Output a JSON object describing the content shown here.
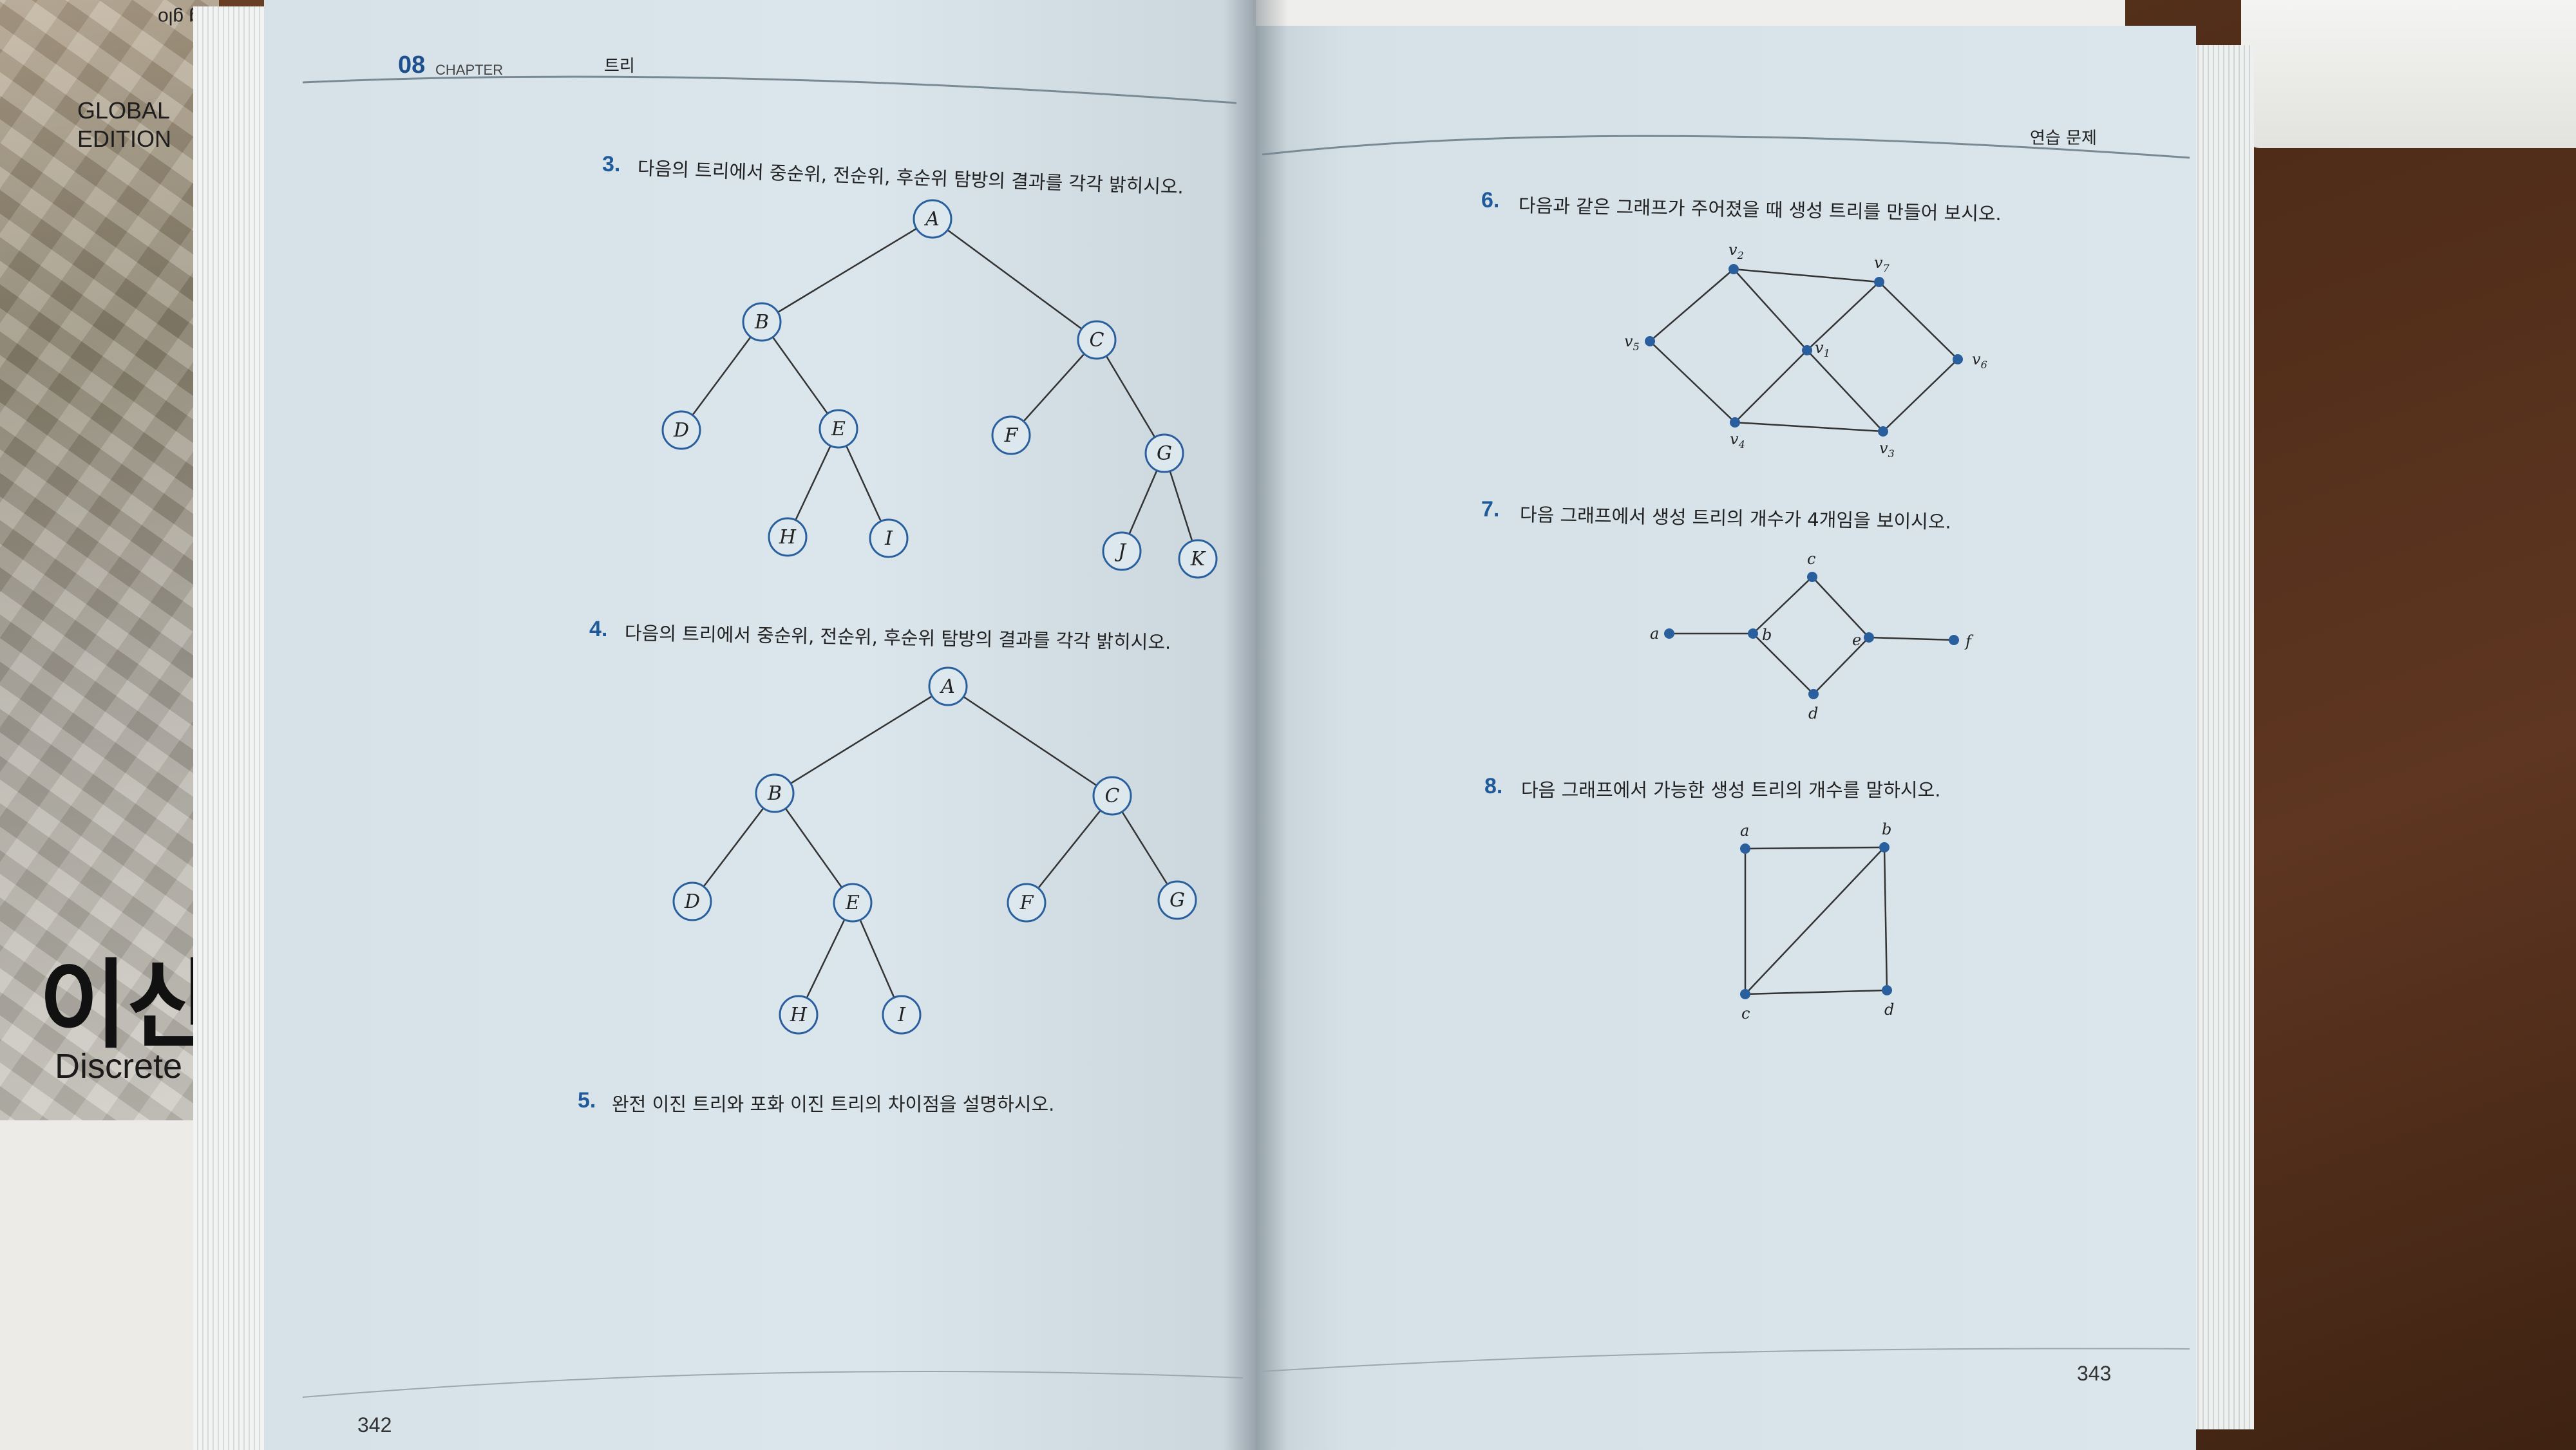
{
  "cover": {
    "edition": [
      "GLOBAL",
      "EDITION"
    ],
    "title": "이산",
    "subtitle": "Discrete",
    "spine": "ing glo"
  },
  "left_page": {
    "chapter_number": "08",
    "chapter_word": "CHAPTER",
    "chapter_title": "트리",
    "page_number": "342",
    "q3": {
      "num": "3.",
      "text": "다음의 트리에서 중순위, 전순위, 후순위 탐방의 결과를 각각 밝히시오."
    },
    "q4": {
      "num": "4.",
      "text": "다음의 트리에서 중순위, 전순위, 후순위 탐방의 결과를 각각 밝히시오."
    },
    "q5": {
      "num": "5.",
      "text": "완전 이진 트리와 포화 이진 트리의 차이점을 설명하시오."
    },
    "tree3_labels": [
      "A",
      "B",
      "C",
      "D",
      "E",
      "F",
      "G",
      "H",
      "I",
      "J",
      "K"
    ],
    "tree4_labels": [
      "A",
      "B",
      "C",
      "D",
      "E",
      "F",
      "G",
      "H",
      "I"
    ]
  },
  "right_page": {
    "header": "연습 문제",
    "page_number": "343",
    "q6": {
      "num": "6.",
      "text": "다음과 같은 그래프가 주어졌을 때 생성 트리를 만들어 보시오."
    },
    "q7": {
      "num": "7.",
      "text": "다음 그래프에서 생성 트리의 개수가 4개임을 보이시오."
    },
    "q8": {
      "num": "8.",
      "text": "다음 그래프에서 가능한 생성 트리의 개수를 말하시오."
    },
    "graph6_labels": [
      "v",
      "v",
      "v",
      "v",
      "v",
      "v"
    ],
    "graph6_subs": [
      "2",
      "7",
      "5",
      "1",
      "6",
      "4",
      "3"
    ],
    "graph7_labels": [
      "a",
      "b",
      "c",
      "d",
      "e",
      "f"
    ],
    "graph8_labels": [
      "a",
      "b",
      "c",
      "d"
    ]
  },
  "colors": {
    "accent": "#1f5a9a",
    "node_stroke": "#2a5f9e",
    "page": "#d8e4ea"
  }
}
